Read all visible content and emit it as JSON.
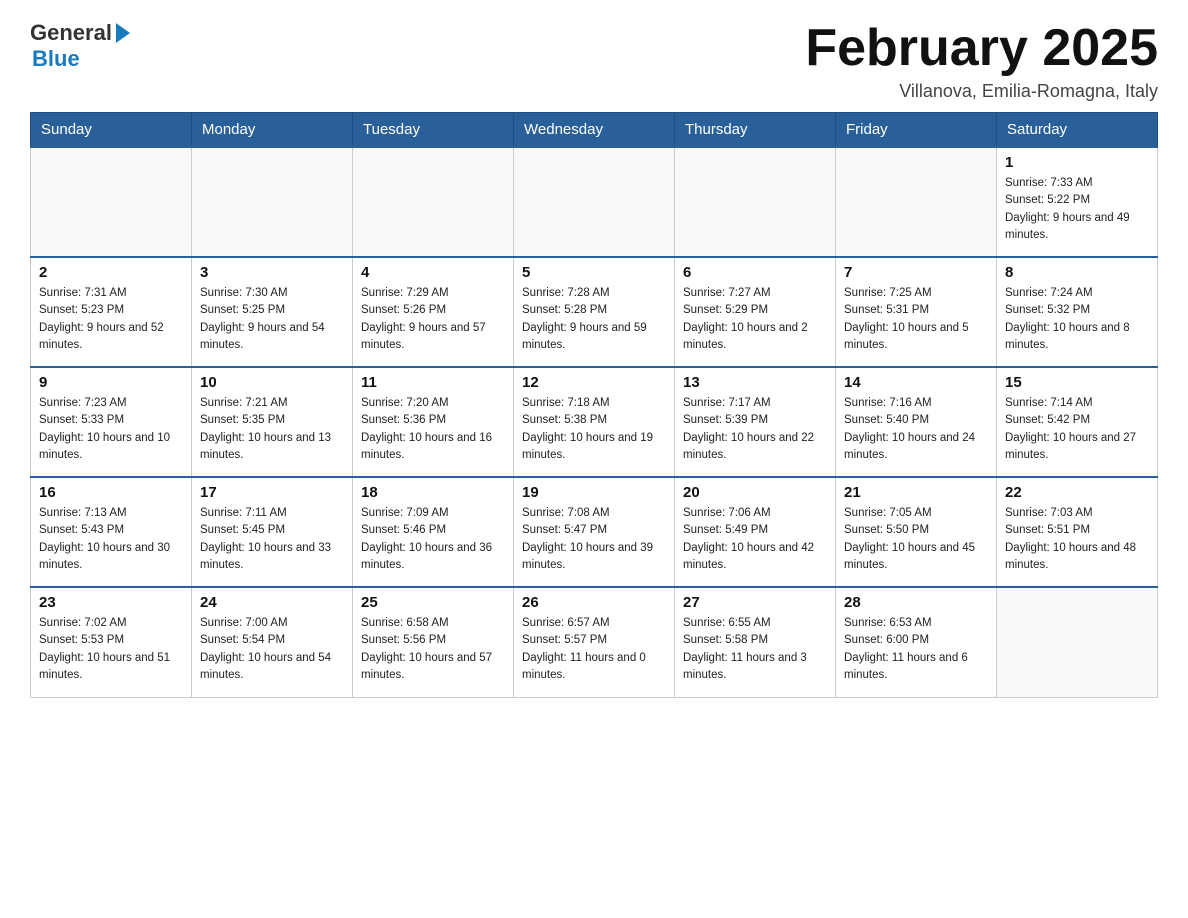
{
  "logo": {
    "general": "General",
    "blue": "Blue"
  },
  "title": "February 2025",
  "location": "Villanova, Emilia-Romagna, Italy",
  "days_of_week": [
    "Sunday",
    "Monday",
    "Tuesday",
    "Wednesday",
    "Thursday",
    "Friday",
    "Saturday"
  ],
  "weeks": [
    [
      {
        "day": "",
        "info": ""
      },
      {
        "day": "",
        "info": ""
      },
      {
        "day": "",
        "info": ""
      },
      {
        "day": "",
        "info": ""
      },
      {
        "day": "",
        "info": ""
      },
      {
        "day": "",
        "info": ""
      },
      {
        "day": "1",
        "info": "Sunrise: 7:33 AM\nSunset: 5:22 PM\nDaylight: 9 hours and 49 minutes."
      }
    ],
    [
      {
        "day": "2",
        "info": "Sunrise: 7:31 AM\nSunset: 5:23 PM\nDaylight: 9 hours and 52 minutes."
      },
      {
        "day": "3",
        "info": "Sunrise: 7:30 AM\nSunset: 5:25 PM\nDaylight: 9 hours and 54 minutes."
      },
      {
        "day": "4",
        "info": "Sunrise: 7:29 AM\nSunset: 5:26 PM\nDaylight: 9 hours and 57 minutes."
      },
      {
        "day": "5",
        "info": "Sunrise: 7:28 AM\nSunset: 5:28 PM\nDaylight: 9 hours and 59 minutes."
      },
      {
        "day": "6",
        "info": "Sunrise: 7:27 AM\nSunset: 5:29 PM\nDaylight: 10 hours and 2 minutes."
      },
      {
        "day": "7",
        "info": "Sunrise: 7:25 AM\nSunset: 5:31 PM\nDaylight: 10 hours and 5 minutes."
      },
      {
        "day": "8",
        "info": "Sunrise: 7:24 AM\nSunset: 5:32 PM\nDaylight: 10 hours and 8 minutes."
      }
    ],
    [
      {
        "day": "9",
        "info": "Sunrise: 7:23 AM\nSunset: 5:33 PM\nDaylight: 10 hours and 10 minutes."
      },
      {
        "day": "10",
        "info": "Sunrise: 7:21 AM\nSunset: 5:35 PM\nDaylight: 10 hours and 13 minutes."
      },
      {
        "day": "11",
        "info": "Sunrise: 7:20 AM\nSunset: 5:36 PM\nDaylight: 10 hours and 16 minutes."
      },
      {
        "day": "12",
        "info": "Sunrise: 7:18 AM\nSunset: 5:38 PM\nDaylight: 10 hours and 19 minutes."
      },
      {
        "day": "13",
        "info": "Sunrise: 7:17 AM\nSunset: 5:39 PM\nDaylight: 10 hours and 22 minutes."
      },
      {
        "day": "14",
        "info": "Sunrise: 7:16 AM\nSunset: 5:40 PM\nDaylight: 10 hours and 24 minutes."
      },
      {
        "day": "15",
        "info": "Sunrise: 7:14 AM\nSunset: 5:42 PM\nDaylight: 10 hours and 27 minutes."
      }
    ],
    [
      {
        "day": "16",
        "info": "Sunrise: 7:13 AM\nSunset: 5:43 PM\nDaylight: 10 hours and 30 minutes."
      },
      {
        "day": "17",
        "info": "Sunrise: 7:11 AM\nSunset: 5:45 PM\nDaylight: 10 hours and 33 minutes."
      },
      {
        "day": "18",
        "info": "Sunrise: 7:09 AM\nSunset: 5:46 PM\nDaylight: 10 hours and 36 minutes."
      },
      {
        "day": "19",
        "info": "Sunrise: 7:08 AM\nSunset: 5:47 PM\nDaylight: 10 hours and 39 minutes."
      },
      {
        "day": "20",
        "info": "Sunrise: 7:06 AM\nSunset: 5:49 PM\nDaylight: 10 hours and 42 minutes."
      },
      {
        "day": "21",
        "info": "Sunrise: 7:05 AM\nSunset: 5:50 PM\nDaylight: 10 hours and 45 minutes."
      },
      {
        "day": "22",
        "info": "Sunrise: 7:03 AM\nSunset: 5:51 PM\nDaylight: 10 hours and 48 minutes."
      }
    ],
    [
      {
        "day": "23",
        "info": "Sunrise: 7:02 AM\nSunset: 5:53 PM\nDaylight: 10 hours and 51 minutes."
      },
      {
        "day": "24",
        "info": "Sunrise: 7:00 AM\nSunset: 5:54 PM\nDaylight: 10 hours and 54 minutes."
      },
      {
        "day": "25",
        "info": "Sunrise: 6:58 AM\nSunset: 5:56 PM\nDaylight: 10 hours and 57 minutes."
      },
      {
        "day": "26",
        "info": "Sunrise: 6:57 AM\nSunset: 5:57 PM\nDaylight: 11 hours and 0 minutes."
      },
      {
        "day": "27",
        "info": "Sunrise: 6:55 AM\nSunset: 5:58 PM\nDaylight: 11 hours and 3 minutes."
      },
      {
        "day": "28",
        "info": "Sunrise: 6:53 AM\nSunset: 6:00 PM\nDaylight: 11 hours and 6 minutes."
      },
      {
        "day": "",
        "info": ""
      }
    ]
  ]
}
